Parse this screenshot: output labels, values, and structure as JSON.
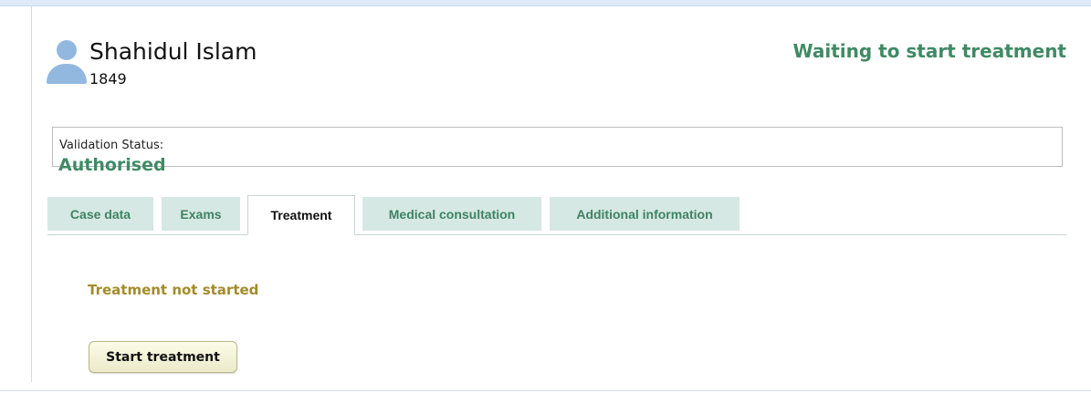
{
  "patient": {
    "name": "Shahidul Islam",
    "id": "1849",
    "avatar_icon": "user-avatar-icon"
  },
  "case_status": "Waiting to start treatment",
  "validation": {
    "label": "Validation Status:",
    "value": "Authorised"
  },
  "tabs": [
    {
      "label": "Case data",
      "active": false
    },
    {
      "label": "Exams",
      "active": false
    },
    {
      "label": "Treatment",
      "active": true
    },
    {
      "label": "Medical consultation",
      "active": false
    },
    {
      "label": "Additional information",
      "active": false
    }
  ],
  "treatment": {
    "status_text": "Treatment not started",
    "start_button_label": "Start treatment"
  },
  "colors": {
    "accent_green": "#3f8a64",
    "tab_background": "#d6e8e3",
    "treatment_status": "#a38b2a",
    "avatar": "#93b8df"
  }
}
